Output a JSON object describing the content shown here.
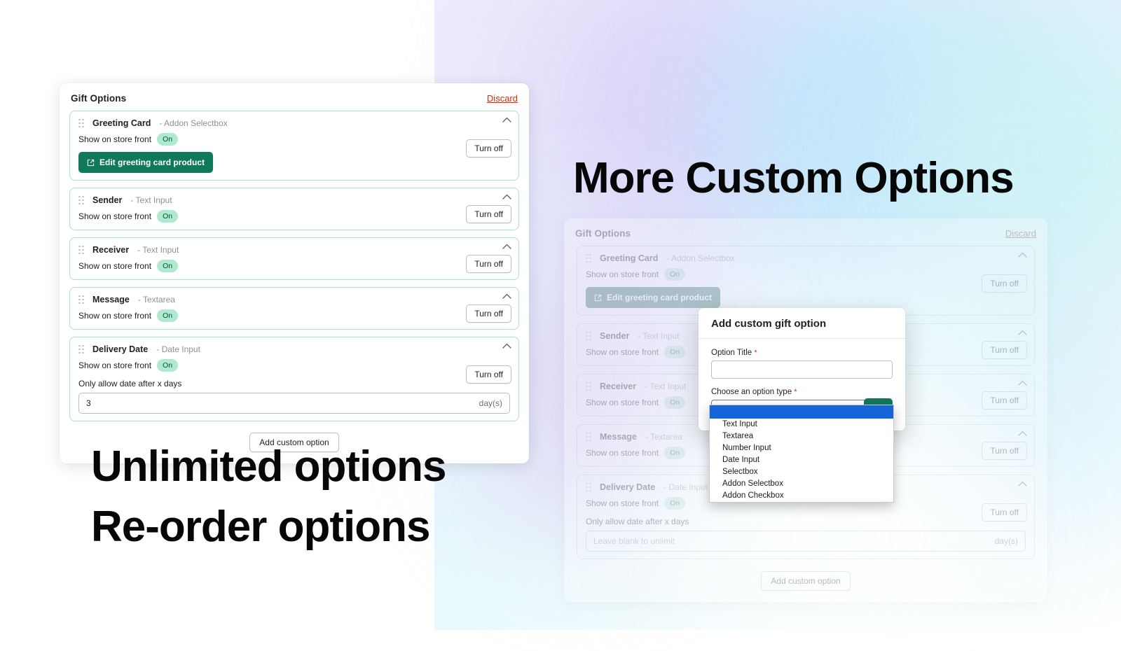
{
  "headlines": {
    "left_line1": "Unlimited options",
    "left_line2": "Re-order options",
    "right": "More Custom Options"
  },
  "panel": {
    "title": "Gift Options",
    "discard_label": "Discard",
    "add_custom_option_label": "Add custom option",
    "show_label": "Show on store front",
    "badge_on": "On",
    "turn_off_label": "Turn off",
    "edit_greeting_card_label": "Edit greeting card product",
    "delivery_sub_label": "Only allow date after x days",
    "delivery_suffix": "day(s)",
    "delivery_value_left": "3",
    "delivery_placeholder_right": "Leave blank to unlimit",
    "options": [
      {
        "name": "Greeting Card",
        "type": "Addon Selectbox"
      },
      {
        "name": "Sender",
        "type": "Text Input"
      },
      {
        "name": "Receiver",
        "type": "Text Input"
      },
      {
        "name": "Message",
        "type": "Textarea"
      },
      {
        "name": "Delivery Date",
        "type": "Date Input"
      }
    ]
  },
  "modal": {
    "title": "Add custom gift option",
    "option_title_label": "Option Title",
    "option_title_value": "",
    "option_type_label": "Choose an option type",
    "option_type_value": "",
    "required_mark": "*",
    "dropdown_options": [
      "",
      "Text Input",
      "Textarea",
      "Number Input",
      "Date Input",
      "Selectbox",
      "Addon Selectbox",
      "Addon Checkbox"
    ]
  },
  "colors": {
    "accent_green": "#10795a",
    "badge_green_bg": "#aee9d1",
    "badge_green_text": "#0c5132",
    "discard_red": "#d82c0d",
    "card_border_green": "#aee0c7",
    "dropdown_highlight_blue": "#1565d8",
    "select_focus_purple": "#7b6fd6"
  }
}
